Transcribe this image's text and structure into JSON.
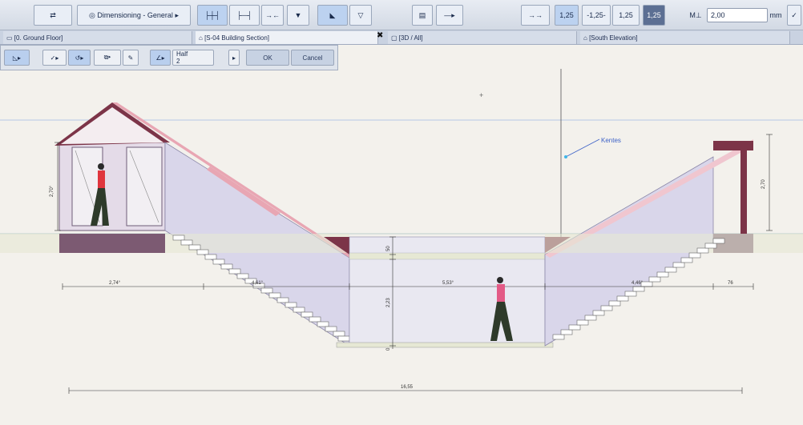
{
  "toolbar": {
    "view_preset": "Dimensioning - General",
    "value_field": "2,00",
    "unit": "mm",
    "dim_labels": [
      "1,25",
      "-1,25-",
      "1,25",
      "1,25"
    ],
    "arrow_button": "⇄"
  },
  "tabs": [
    {
      "label": "[0. Ground Floor]"
    },
    {
      "label": "[S-04 Building Section]"
    },
    {
      "label": "[3D / All]"
    },
    {
      "label": "[South Elevation]"
    }
  ],
  "subbar": {
    "half_label": "Half",
    "half_value": "2",
    "ok_label": "OK",
    "cancel_label": "Cancel"
  },
  "drawing": {
    "annotation": "Kentes",
    "dims": {
      "left_width": "2,74°",
      "left_ramp": "4,61°",
      "center": "5,53°",
      "right_ramp": "4,46°",
      "right_end": "76",
      "total": "16,55",
      "left_height": "2,70°",
      "right_height": "2,70",
      "center_h1": "50",
      "center_h2": "2,23",
      "center_h3": "0"
    }
  },
  "colors": {
    "wall": "#d9d6ea",
    "roof": "#7c3448",
    "roof_pink": "#e8a6b3",
    "floor": "#e6e8d4",
    "grid_blue": "#4a8de0"
  }
}
